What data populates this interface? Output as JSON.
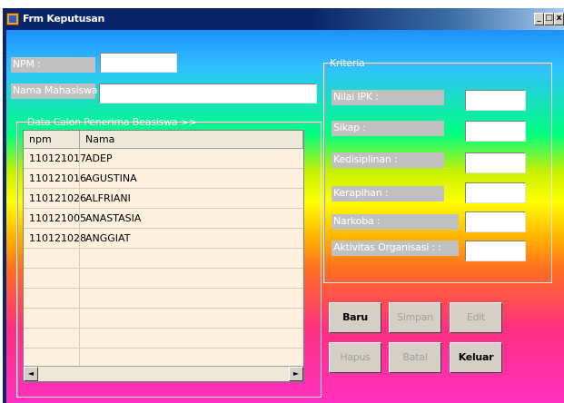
{
  "window": {
    "title": "Frm Keputusan",
    "controls": [
      "_",
      "□",
      "x"
    ]
  },
  "form": {
    "npm_label": "NPM :",
    "npm_value": "",
    "nama_label": "Nama Mahasiswa :",
    "nama_value": ""
  },
  "data_group": {
    "title": "Data Calon Penerima Beasiswa >>",
    "columns": [
      "npm",
      "Nama"
    ],
    "rows": [
      [
        "110121017",
        "ADEP"
      ],
      [
        "110121016",
        "AGUSTINA"
      ],
      [
        "110121026",
        "ALFRIANI"
      ],
      [
        "110121005",
        "ANASTASIA"
      ],
      [
        "110121028",
        "ANGGIAT"
      ]
    ]
  },
  "kriteria": {
    "title": "Kriteria",
    "fields": [
      {
        "label": "Nilai IPK :",
        "value": ""
      },
      {
        "label": "Sikap :",
        "value": ""
      },
      {
        "label": "Kedisiplinan :",
        "value": ""
      },
      {
        "label": "Kerapihan :",
        "value": ""
      },
      {
        "label": "Narkoba :",
        "value": ""
      },
      {
        "label": "Aktivitas Organisasi : :",
        "value": ""
      }
    ]
  },
  "buttons": {
    "baru": "Baru",
    "simpan": "Simpan",
    "edit": "Edit",
    "hapus": "Hapus",
    "batal": "Batal",
    "keluar": "Keluar"
  },
  "icons": {
    "app": "form-icon",
    "scroll_left": "◄",
    "scroll_right": "►"
  }
}
